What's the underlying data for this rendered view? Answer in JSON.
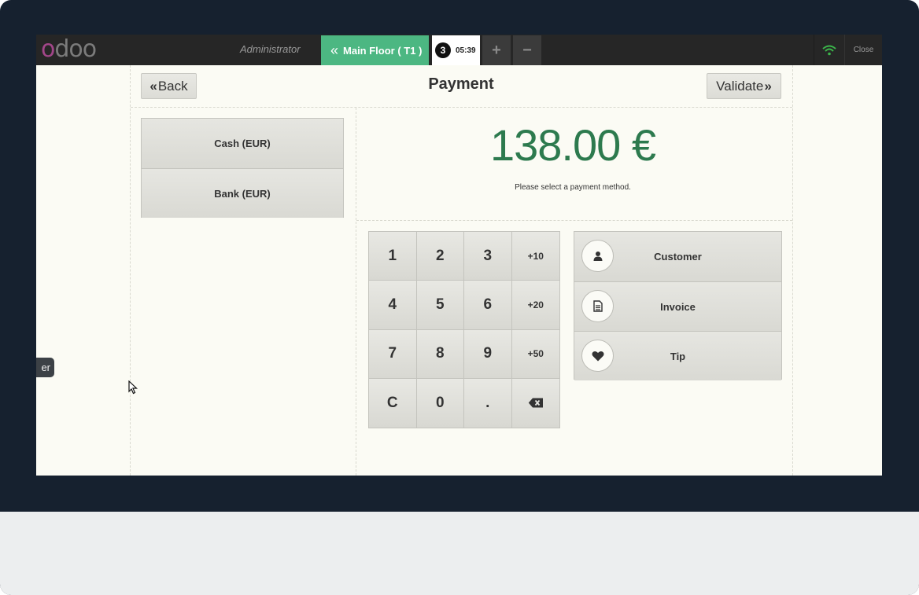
{
  "topbar": {
    "logo_text": "odoo",
    "user_name": "Administrator",
    "floor_tab": "Main Floor ( T1 )",
    "order_number": "3",
    "order_time": "05:39",
    "add_tab": "+",
    "remove_tab": "−",
    "close_label": "Close",
    "wifi_color": "#3bb54a"
  },
  "payment": {
    "back_label": "Back",
    "title": "Payment",
    "validate_label": "Validate",
    "methods": [
      "Cash (EUR)",
      "Bank (EUR)"
    ],
    "amount": "138.00 €",
    "hint": "Please select a payment method.",
    "amount_color": "#2d7a4e"
  },
  "numpad": {
    "keys": [
      "1",
      "2",
      "3",
      "+10",
      "4",
      "5",
      "6",
      "+20",
      "7",
      "8",
      "9",
      "+50",
      "C",
      "0",
      ".",
      "backspace-icon"
    ]
  },
  "actions": {
    "customer": "Customer",
    "invoice": "Invoice",
    "tip": "Tip"
  },
  "tooltip": {
    "text": "er"
  },
  "icons": [
    "wifi-icon",
    "double-chevron-left-icon",
    "double-chevron-right-icon",
    "user-icon",
    "document-icon",
    "heart-icon",
    "backspace-icon",
    "mouse-cursor-icon"
  ]
}
